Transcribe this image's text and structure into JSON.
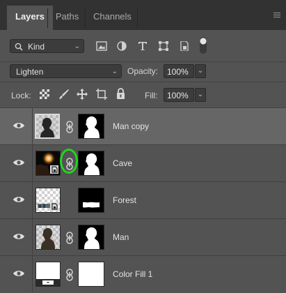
{
  "tabs": [
    {
      "label": "Layers",
      "active": true
    },
    {
      "label": "Paths",
      "active": false
    },
    {
      "label": "Channels",
      "active": false
    }
  ],
  "filter": {
    "kind_label": "Kind",
    "icons": [
      "pixel-filter-icon",
      "adjustment-filter-icon",
      "type-filter-icon",
      "shape-filter-icon",
      "smart-object-filter-icon",
      "filter-toggle-icon"
    ]
  },
  "blend": {
    "mode": "Lighten",
    "opacity_label": "Opacity:",
    "opacity_value": "100%"
  },
  "lock": {
    "label": "Lock:",
    "icons": [
      "lock-transparent-icon",
      "lock-image-icon",
      "lock-position-icon",
      "lock-artboard-icon",
      "lock-all-icon"
    ],
    "fill_label": "Fill:",
    "fill_value": "100%"
  },
  "layers": [
    {
      "name": "Man copy",
      "selected": true
    },
    {
      "name": "Cave",
      "selected": false
    },
    {
      "name": "Forest",
      "selected": false
    },
    {
      "name": "Man",
      "selected": false
    },
    {
      "name": "Color Fill 1",
      "selected": false
    }
  ],
  "colors": {
    "panel_bg": "#535353",
    "tab_bar_bg": "#323232",
    "selected_layer_bg": "#666666",
    "highlight_ring": "#1fd61f"
  }
}
